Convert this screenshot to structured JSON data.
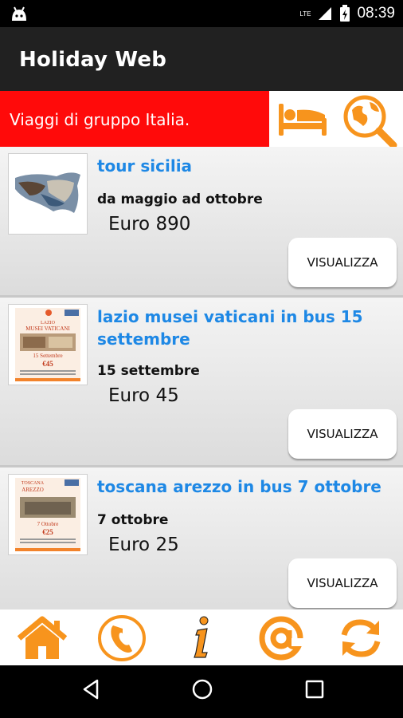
{
  "status": {
    "time": "08:39",
    "network": "LTE"
  },
  "app": {
    "title": "Holiday Web"
  },
  "banner": {
    "text": "Viaggi di gruppo Italia."
  },
  "items": [
    {
      "title": "tour sicilia",
      "dates": "da maggio ad ottobre",
      "price": "Euro 890",
      "button": "VISUALIZZA"
    },
    {
      "title": "lazio musei vaticani in bus 15 settembre",
      "dates": "15 settembre",
      "price": "Euro 45",
      "button": "VISUALIZZA"
    },
    {
      "title": "toscana arezzo in bus 7 ottobre",
      "dates": "7 ottobre",
      "price": "Euro 25",
      "button": "VISUALIZZA"
    }
  ],
  "thumbs": [
    {
      "icon": "sicily-map-image"
    },
    {
      "icon": "lazio-poster-image",
      "heading": "LAZIO",
      "sub": "MUSEI VATICANI",
      "date": "15 Settembre",
      "price": "€45"
    },
    {
      "icon": "arezzo-poster-image",
      "heading": "TOSCANA",
      "sub": "AREZZO",
      "date": "7 Ottobre",
      "price": "€25"
    }
  ],
  "bottom_nav": [
    "home-icon",
    "phone-icon",
    "info-icon",
    "email-icon",
    "refresh-icon"
  ],
  "colors": {
    "accent": "#f7941d",
    "banner_red": "#ff0a0a",
    "title_blue": "#1e88e5",
    "appbar": "#212121"
  }
}
